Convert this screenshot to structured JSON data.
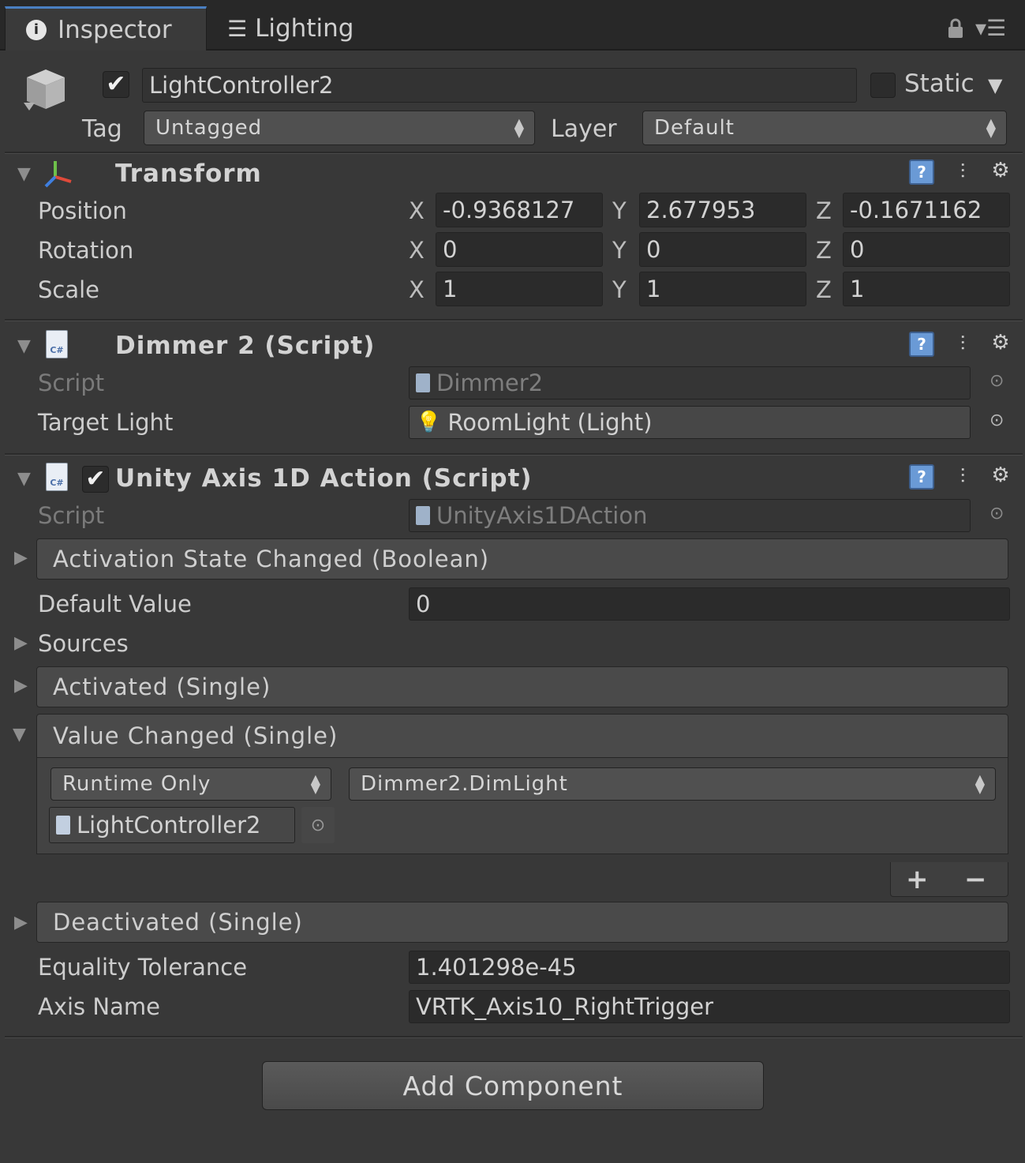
{
  "tabs": [
    {
      "label": "Inspector",
      "icon": "info-icon",
      "active": true
    },
    {
      "label": "Lighting",
      "icon": "sliders-icon",
      "active": false
    }
  ],
  "object": {
    "active": true,
    "name": "LightController2",
    "static_label": "Static",
    "static_checked": false,
    "tag_label": "Tag",
    "tag_value": "Untagged",
    "layer_label": "Layer",
    "layer_value": "Default"
  },
  "transform": {
    "title": "Transform",
    "rows": [
      {
        "label": "Position",
        "x": "-0.9368127",
        "y": "2.677953",
        "z": "-0.1671162"
      },
      {
        "label": "Rotation",
        "x": "0",
        "y": "0",
        "z": "0"
      },
      {
        "label": "Scale",
        "x": "1",
        "y": "1",
        "z": "1"
      }
    ],
    "axis_x": "X",
    "axis_y": "Y",
    "axis_z": "Z"
  },
  "dimmer": {
    "title": "Dimmer 2 (Script)",
    "script_label": "Script",
    "script_value": "Dimmer2",
    "target_label": "Target Light",
    "target_value": "RoomLight (Light)"
  },
  "axis_action": {
    "title": "Unity Axis 1D Action (Script)",
    "enabled": true,
    "script_label": "Script",
    "script_value": "UnityAxis1DAction",
    "activation_event": "Activation State Changed (Boolean)",
    "default_value_label": "Default Value",
    "default_value": "0",
    "sources_label": "Sources",
    "activated_event": "Activated (Single)",
    "value_changed_event": "Value Changed (Single)",
    "runtime_option": "Runtime Only",
    "function_option": "Dimmer2.DimLight",
    "target_object": "LightController2",
    "add_symbol": "+",
    "remove_symbol": "−",
    "deactivated_event": "Deactivated (Single)",
    "tolerance_label": "Equality Tolerance",
    "tolerance_value": "1.401298e-45",
    "axis_name_label": "Axis Name",
    "axis_name_value": "VRTK_Axis10_RightTrigger"
  },
  "add_component_label": "Add Component",
  "colors": {
    "background": "#383838",
    "tab_accent": "#4a7fc1",
    "help_icon": "#6a9ad6"
  }
}
